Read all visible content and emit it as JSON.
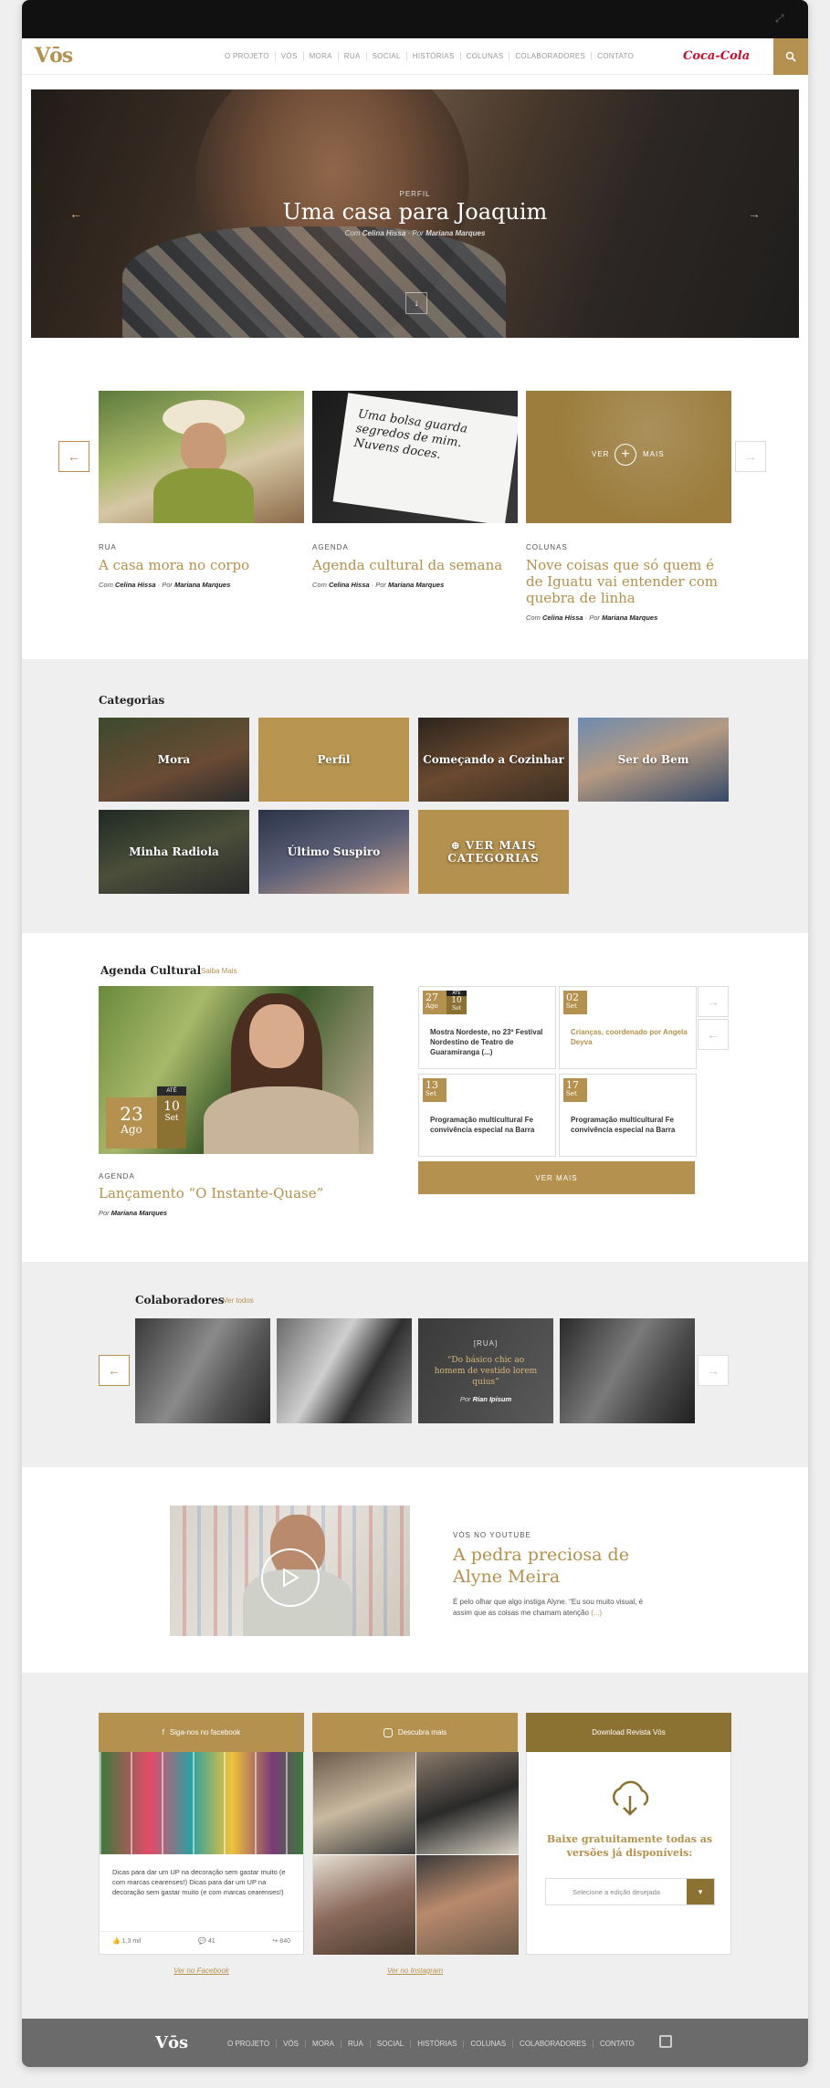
{
  "nav": {
    "logo": "Vōs",
    "links": [
      "O PROJETO",
      "VÓS",
      "MORA",
      "RUA",
      "SOCIAL",
      "HISTÓRIAS",
      "COLUNAS",
      "COLABORADORES",
      "CONTATO"
    ],
    "sponsor": "Coca-Cola"
  },
  "hero": {
    "tag": "PERFIL",
    "title": "Uma casa para Joaquim",
    "by_prefix": "Com",
    "by_with": "Celina Hissa",
    "by_sep": "Por",
    "by_author": "Mariana Marques"
  },
  "featured": [
    {
      "category": "RUA",
      "title": "A casa mora no corpo",
      "with": "Celina Hissa",
      "author": "Mariana Marques"
    },
    {
      "category": "AGENDA",
      "title": "Agenda cultural da semana",
      "with": "Celina Hissa",
      "author": "Mariana Marques",
      "note": "Uma bolsa guarda segredos de mim. Nuvens doces."
    },
    {
      "category": "COLUNAS",
      "title": "Nove coisas que só quem é de Iguatu vai entender com quebra de linha",
      "with": "Celina Hissa",
      "author": "Mariana Marques"
    }
  ],
  "featured_labels": {
    "with": "Com",
    "by": "Por",
    "see_more_left": "VER",
    "see_more_right": "MAIS"
  },
  "categories": {
    "title": "Categorias",
    "items": [
      "Mora",
      "Perfil",
      "Começando a Cozinhar",
      "Ser do Bem",
      "Minha Radiola",
      "Último Suspiro"
    ],
    "more": "VER MAIS CATEGORIAS"
  },
  "agenda": {
    "title": "Agenda Cultural",
    "more_link": "Saiba Mais",
    "main": {
      "until": "ATÉ",
      "day1": "23",
      "month1": "Ago",
      "day2": "10",
      "month2": "Set",
      "category": "AGENDA",
      "title": "Lançamento “O Instante-Quase”",
      "by": "Por",
      "author": "Mariana Marques"
    },
    "events": [
      {
        "day": "27",
        "month": "Ago",
        "until": "ATÉ",
        "day2": "10",
        "month2": "Set",
        "text": "Mostra Nordeste, no 23º Festival Nordestino de Teatro de Guaramiranga (...)"
      },
      {
        "day": "02",
        "month": "Set",
        "text": "Crianças, coordenado por Angela Deyva"
      },
      {
        "day": "13",
        "month": "Set",
        "text": "Programação multicultural Fe convivência especial na Barra"
      },
      {
        "day": "17",
        "month": "Set",
        "text": "Programação multicultural Fe convivência especial na Barra"
      }
    ],
    "button": "VER MAIS"
  },
  "colaboradores": {
    "title": "Colaboradores",
    "more_link": "Ver todos",
    "quote_tag": "[RUA]",
    "quote": "“Do básico chic ao homem de vestido lorem quius”",
    "quote_by": "Por",
    "quote_author": "Rian Ipisum"
  },
  "video": {
    "tag": "VÓS NO YOUTUBE",
    "title": "A pedra preciosa de Alyne Meira",
    "text": "É pelo olhar que algo instiga Alyne. “Eu sou muito visual, é assim que as coisas me chamam atenção",
    "more": "(...)"
  },
  "social": {
    "facebook": {
      "header": "Siga-nos no facebook",
      "post": "Dicas para dar um UP na decoração sem gastar muito (e com marcas cearenses!) Dicas para dar um UP na decoração sem gastar muito (e com marcas cearenses!)",
      "likes": "1,3 mil",
      "comments": "41",
      "shares": "840",
      "link": "Ver no Facebook"
    },
    "instagram": {
      "header": "Descubra mais",
      "link": "Ver no Instagram"
    },
    "download": {
      "header": "Download Revista Vōs",
      "text": "Baixe gratuitamente todas as versões já disponíveis:",
      "select_placeholder": "Selecione a edição desejada"
    }
  },
  "footer": {
    "logo": "Vōs",
    "links": [
      "O PROJETO",
      "VÓS",
      "MORA",
      "RUA",
      "SOCIAL",
      "HISTÓRIAS",
      "COLUNAS",
      "COLABORADORES",
      "CONTATO"
    ]
  },
  "colors": {
    "accent": "#b4914e",
    "dark_accent": "#8b7132",
    "footer": "#6b6b6b"
  }
}
